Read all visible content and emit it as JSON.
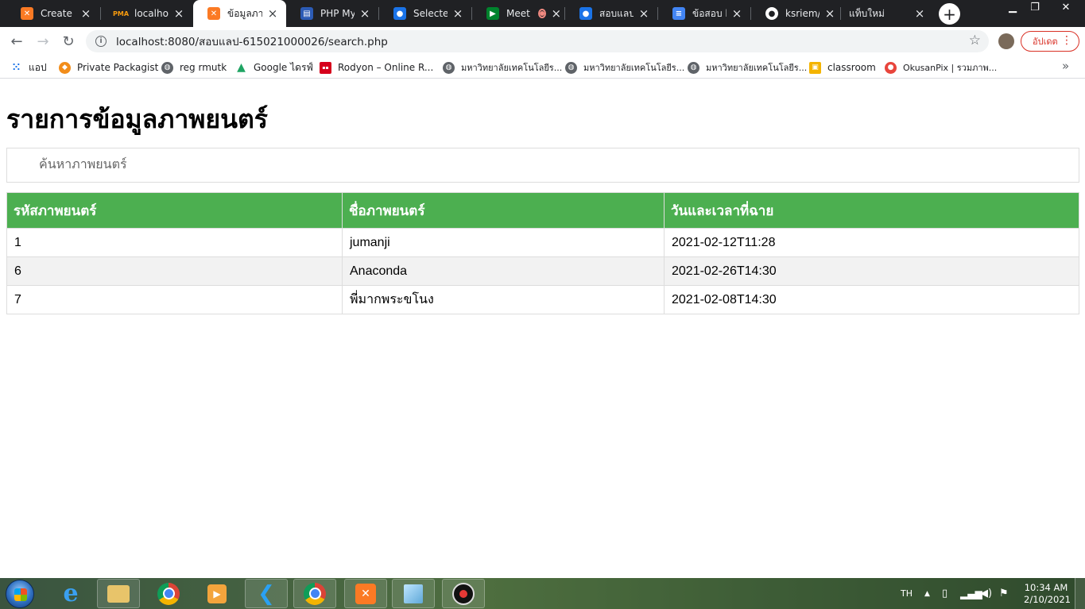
{
  "browser": {
    "tabs": [
      {
        "title": "Create Re",
        "icon": "xampp-icon",
        "color": "#fb7a24"
      },
      {
        "title": "localhost/",
        "icon": "phpmyadmin-icon",
        "color": "#f89c0e"
      },
      {
        "title": "ข้อมูลภาพย",
        "icon": "xampp-icon",
        "color": "#fb7a24",
        "active": true
      },
      {
        "title": "PHP MySQ",
        "icon": "page-icon",
        "color": "#2c5bb5"
      },
      {
        "title": "Selected T",
        "icon": "classroom-person-icon",
        "color": "#1a73e8"
      },
      {
        "title": "Meet",
        "icon": "meet-icon",
        "color": "#00832d",
        "recording": true
      },
      {
        "title": "สอบแลป",
        "icon": "classroom-person-icon",
        "color": "#1a73e8"
      },
      {
        "title": "ข้อสอบ lab",
        "icon": "docs-icon",
        "color": "#4285f4"
      },
      {
        "title": "ksriem/ex",
        "icon": "github-icon",
        "color": "#ffffff"
      },
      {
        "title": "แท็บใหม่",
        "icon": "",
        "color": ""
      }
    ],
    "url": "localhost:8080/สอบแลป-615021000026/search.php",
    "update_label": "อัปเดต",
    "bookmarks": [
      {
        "label": "แอป",
        "icon": "apps-grid-icon",
        "color": "#1a73e8"
      },
      {
        "label": "Private Packagist",
        "icon": "packagist-icon",
        "color": "#f28d1a"
      },
      {
        "label": "reg rmutk",
        "icon": "globe-icon",
        "color": "#5f6368"
      },
      {
        "label": "Google ไดรฟ์",
        "icon": "drive-icon",
        "color": "#1fa463"
      },
      {
        "label": "Rodyon – Online R...",
        "icon": "rodyon-icon",
        "color": "#d6001c"
      },
      {
        "label": "มหาวิทยาลัยเทคโนโลยีร...",
        "icon": "globe-icon",
        "color": "#5f6368"
      },
      {
        "label": "มหาวิทยาลัยเทคโนโลยีร...",
        "icon": "globe-icon",
        "color": "#5f6368"
      },
      {
        "label": "มหาวิทยาลัยเทคโนโลยีร...",
        "icon": "globe-icon",
        "color": "#5f6368"
      },
      {
        "label": "classroom",
        "icon": "classroom-icon",
        "color": "#f4b400"
      },
      {
        "label": "OkusanPix | รวมภาพ...",
        "icon": "okusanpix-icon",
        "color": "#e8453c"
      }
    ]
  },
  "page": {
    "title": "รายการข้อมูลภาพยนตร์",
    "search_placeholder": "ค้นหาภาพยนตร์",
    "table": {
      "headers": [
        "รหัสภาพยนตร์",
        "ชื่อภาพยนตร์",
        "วันและเวลาที่ฉาย"
      ],
      "rows": [
        [
          "1",
          "jumanji",
          "2021-02-12T11:28"
        ],
        [
          "6",
          "Anaconda",
          "2021-02-26T14:30"
        ],
        [
          "7",
          "พี่มากพระขโนง",
          "2021-02-08T14:30"
        ]
      ]
    },
    "accent_color": "#4CAF50"
  },
  "taskbar": {
    "apps": [
      "start-button",
      "internet-explorer-icon",
      "file-explorer-icon",
      "chrome-icon",
      "media-player-icon",
      "vscode-icon",
      "chrome-icon",
      "xampp-icon",
      "notepad-icon",
      "recorder-icon"
    ],
    "language": "TH",
    "time": "10:34 AM",
    "date": "2/10/2021"
  }
}
